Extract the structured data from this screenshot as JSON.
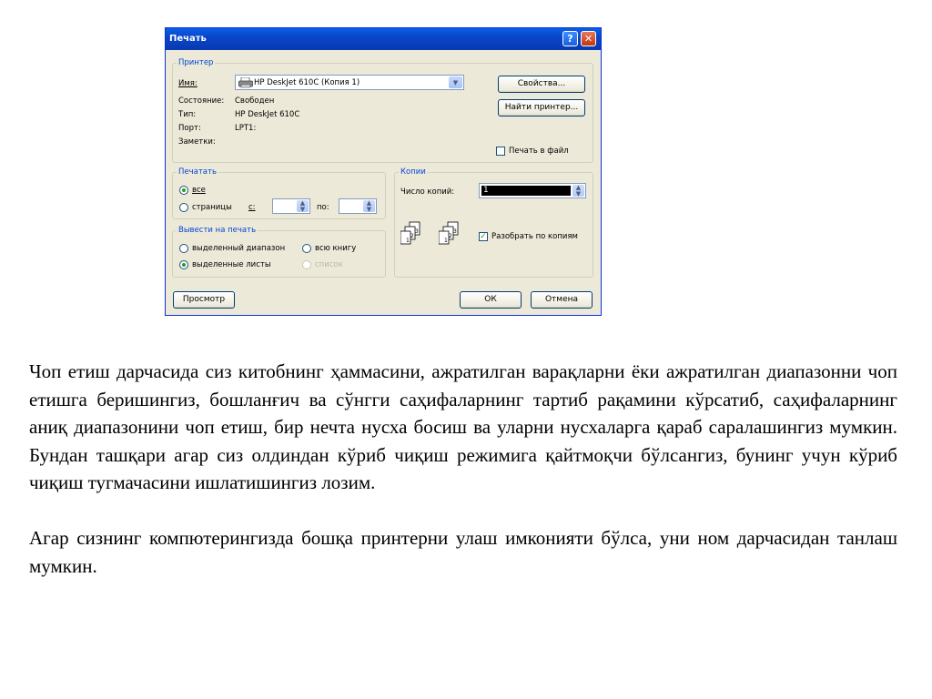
{
  "dialog": {
    "title": "Печать",
    "help_button": "?",
    "close_button": "✕",
    "printer": {
      "legend": "Принтер",
      "name_label": "Имя:",
      "name_value": "HP DeskJet 610C (Копия 1)",
      "status_label": "Состояние:",
      "status_value": "Свободен",
      "type_label": "Тип:",
      "type_value": "HP DeskJet 610C",
      "port_label": "Порт:",
      "port_value": "LPT1:",
      "notes_label": "Заметки:",
      "properties_button": "Свойства...",
      "find_printer_button": "Найти принтер...",
      "print_to_file_label": "Печать в файл",
      "print_to_file_checked": false
    },
    "print_range": {
      "legend": "Печатать",
      "all_label": "все",
      "all_selected": true,
      "pages_label": "страницы",
      "from_label": "с:",
      "to_label": "по:",
      "from_value": "",
      "to_value": ""
    },
    "copies": {
      "legend": "Копии",
      "count_label": "Число копий:",
      "count_value": "1",
      "collate_label": "Разобрать по копиям",
      "collate_checked": true,
      "icon": "collate-pages-icon"
    },
    "print_what": {
      "legend": "Вывести на печать",
      "selection_label": "выделенный диапазон",
      "whole_book_label": "всю книгу",
      "sheets_label": "выделенные листы",
      "sheets_selected": true,
      "list_label": "список"
    },
    "preview_button": "Просмотр",
    "ok_button": "ОК",
    "cancel_button": "Отмена"
  },
  "text": {
    "paragraph1": "Чоп етиш дарчасида сиз китобнинг ҳаммасини, ажратилган варақларни ёки ажратилган диапазонни чоп етишга беришингиз, бошланғич ва сўнгги саҳифаларнинг тартиб рақамини кўрсатиб, саҳифаларнинг аниқ диапазонини чоп етиш, бир нечта нусха босиш ва уларни нусхаларга қараб саралашингиз мумкин. Бундан ташқари агар сиз олдиндан кўриб чиқиш режимига қайтмоқчи бўлсангиз, бунинг учун кўриб чиқиш тугмачасини ишлатишингиз лозим.",
    "paragraph2": "Агар сизнинг компютерингизда бошқа принтерни улаш имконияти бўлса, уни ном дарчасидан танлаш мумкин."
  }
}
